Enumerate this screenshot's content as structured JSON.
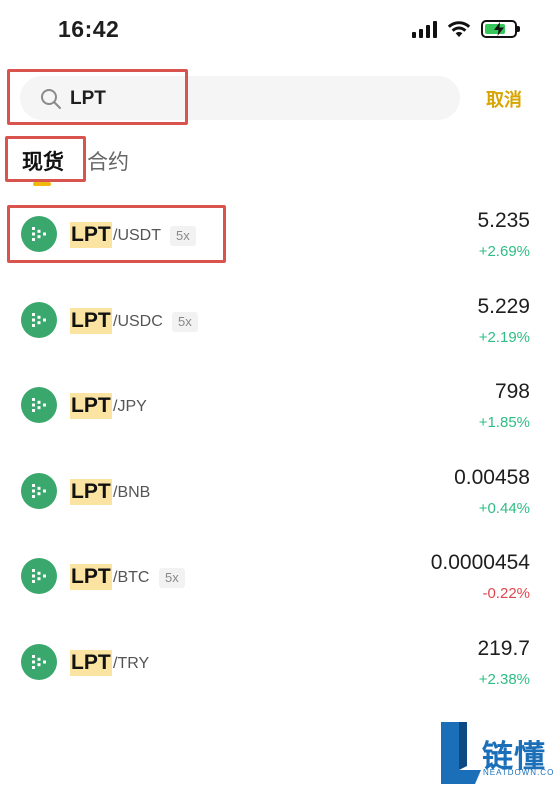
{
  "status_bar": {
    "time": "16:42",
    "icons": [
      "signal-icon",
      "wifi-icon",
      "battery-charging-icon"
    ],
    "battery_level": 0.7
  },
  "search": {
    "value": "LPT",
    "cancel_label": "取消"
  },
  "tabs": [
    {
      "label": "现货",
      "active": true
    },
    {
      "label": "合约",
      "active": false
    }
  ],
  "colors": {
    "accent": "#f0b90b",
    "cancel": "#d8a400",
    "up": "#2ebd85",
    "down": "#e0464f",
    "coin_logo": "#3aa76d",
    "highlight": "#fbe3a1",
    "annotation_red": "#d9534f"
  },
  "markets": [
    {
      "base": "LPT",
      "quote": "/USDT",
      "leverage": "5x",
      "price": "5.235",
      "change": "+2.69%",
      "direction": "up"
    },
    {
      "base": "LPT",
      "quote": "/USDC",
      "leverage": "5x",
      "price": "5.229",
      "change": "+2.19%",
      "direction": "up"
    },
    {
      "base": "LPT",
      "quote": "/JPY",
      "leverage": "",
      "price": "798",
      "change": "+1.85%",
      "direction": "up"
    },
    {
      "base": "LPT",
      "quote": "/BNB",
      "leverage": "",
      "price": "0.00458",
      "change": "+0.44%",
      "direction": "up"
    },
    {
      "base": "LPT",
      "quote": "/BTC",
      "leverage": "5x",
      "price": "0.0000454",
      "change": "-0.22%",
      "direction": "down"
    },
    {
      "base": "LPT",
      "quote": "/TRY",
      "leverage": "",
      "price": "219.7",
      "change": "+2.38%",
      "direction": "up"
    }
  ],
  "watermark": {
    "text": "链懂",
    "sub": "NEATDOWN.COM"
  }
}
